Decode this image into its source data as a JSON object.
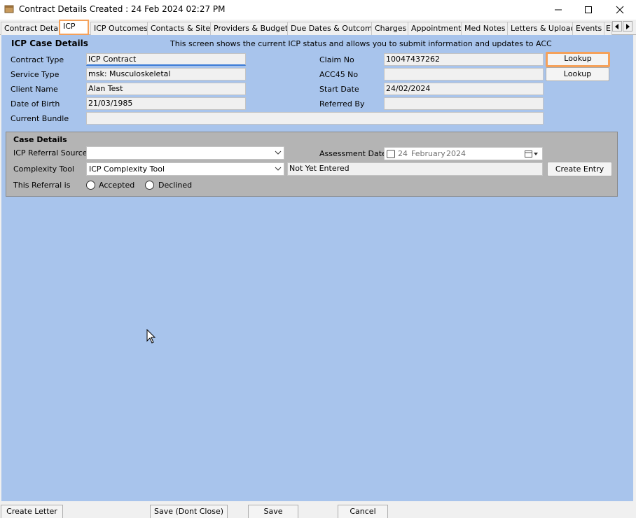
{
  "window": {
    "title": "Contract Details Created : 24 Feb 2024 02:27 PM",
    "icons": [
      "app-icon",
      "minimize-icon",
      "maximize-icon",
      "close-icon"
    ]
  },
  "tabs": [
    {
      "label": "Contract Details"
    },
    {
      "label": "ICP"
    },
    {
      "label": "ICP Outcomes"
    },
    {
      "label": "Contacts & Sites"
    },
    {
      "label": "Providers & Budgets"
    },
    {
      "label": "Due Dates & Outcomes"
    },
    {
      "label": "Charges"
    },
    {
      "label": "Appointments"
    },
    {
      "label": "Med Notes"
    },
    {
      "label": "Letters & Uploads"
    },
    {
      "label": "Events"
    },
    {
      "label": "E"
    }
  ],
  "icp": {
    "section_title": "ICP Case Details",
    "info_text": "This screen shows the current ICP status and allows you to submit information and updates to ACC",
    "contract_type": {
      "label": "Contract Type",
      "value": "ICP Contract"
    },
    "service_type": {
      "label": "Service Type",
      "value": "msk: Musculoskeletal"
    },
    "client_name": {
      "label": "Client Name",
      "value": "Alan Test"
    },
    "date_of_birth": {
      "label": "Date of Birth",
      "value": "21/03/1985"
    },
    "current_bundle": {
      "label": "Current Bundle",
      "value": ""
    },
    "claim_no": {
      "label": "Claim No",
      "value": "10047437262"
    },
    "acc45_no": {
      "label": "ACC45 No",
      "value": ""
    },
    "start_date": {
      "label": "Start Date",
      "value": "24/02/2024"
    },
    "referred_by": {
      "label": "Referred By",
      "value": ""
    },
    "lookup_claim_label": "Lookup",
    "lookup_acc45_label": "Lookup"
  },
  "case_details": {
    "title": "Case Details",
    "referral_source": {
      "label": "ICP Referral Source",
      "value": ""
    },
    "complexity_tool": {
      "label": "Complexity Tool",
      "value": "ICP Complexity Tool"
    },
    "complexity_status": "Not Yet Entered",
    "create_entry_label": "Create Entry",
    "assessment_date": {
      "label": "Assessment Date",
      "day": "24",
      "month": "February",
      "year": "2024"
    },
    "referral_is": {
      "label": "This Referral is",
      "accepted": "Accepted",
      "declined": "Declined"
    }
  },
  "footer": {
    "create_letter": "Create Letter",
    "save_dont_close": "Save (Dont Close)",
    "save": "Save",
    "cancel": "Cancel"
  },
  "colors": {
    "panel_bg": "#a8c4ec",
    "highlight": "#f5a15a",
    "case_box_bg": "#b4b4b4"
  }
}
